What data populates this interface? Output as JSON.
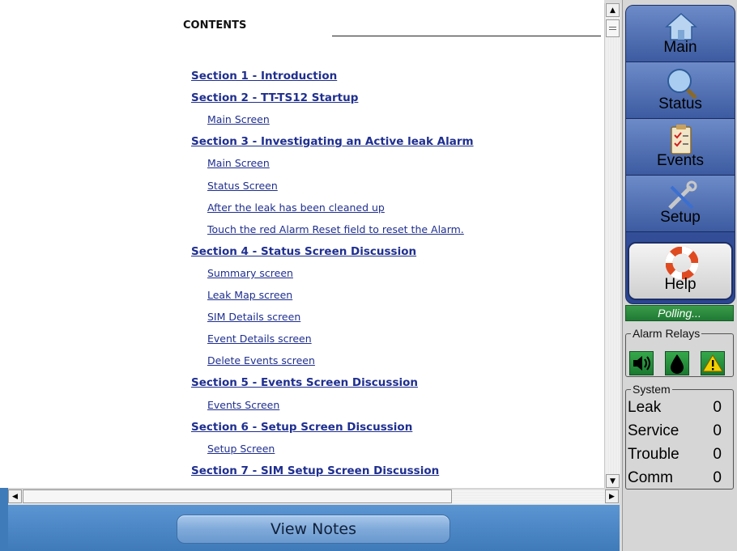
{
  "document": {
    "contents_title": "CONTENTS",
    "toc": [
      {
        "label": "Section 1 - Introduction",
        "level": "section"
      },
      {
        "label": "Section 2 - TT-TS12 Startup",
        "level": "section"
      },
      {
        "label": "Main Screen",
        "level": "sub"
      },
      {
        "label": "Section 3 - Investigating an Active leak Alarm",
        "level": "section"
      },
      {
        "label": "Main Screen",
        "level": "sub"
      },
      {
        "label": "Status Screen",
        "level": "sub"
      },
      {
        "label": "After the leak has been cleaned up",
        "level": "sub"
      },
      {
        "label": "Touch the red Alarm Reset field to reset the Alarm.",
        "level": "sub"
      },
      {
        "label": "Section 4 - Status Screen Discussion",
        "level": "section"
      },
      {
        "label": "Summary screen",
        "level": "sub"
      },
      {
        "label": "Leak Map screen",
        "level": "sub"
      },
      {
        "label": "SIM Details screen",
        "level": "sub"
      },
      {
        "label": "Event Details screen",
        "level": "sub"
      },
      {
        "label": "Delete Events screen",
        "level": "sub"
      },
      {
        "label": "Section 5 - Events Screen Discussion",
        "level": "section"
      },
      {
        "label": "Events Screen",
        "level": "sub"
      },
      {
        "label": "Section 6 - Setup Screen Discussion",
        "level": "section"
      },
      {
        "label": "Setup Screen",
        "level": "sub"
      },
      {
        "label": "Section 7 - SIM Setup Screen Discussion",
        "level": "section"
      }
    ]
  },
  "bottom_bar": {
    "view_notes_label": "View Notes"
  },
  "nav": {
    "main_label": "Main",
    "status_label": "Status",
    "events_label": "Events",
    "setup_label": "Setup",
    "help_label": "Help"
  },
  "polling_status": "Polling...",
  "alarm_relays": {
    "title": "Alarm Relays",
    "icons": [
      "speaker-icon",
      "drop-icon",
      "warning-icon"
    ]
  },
  "system": {
    "title": "System",
    "rows": [
      {
        "label": "Leak",
        "value": "0"
      },
      {
        "label": "Service",
        "value": "0"
      },
      {
        "label": "Trouble",
        "value": "0"
      },
      {
        "label": "Comm",
        "value": "0"
      }
    ]
  },
  "colors": {
    "link": "#1f2f8f",
    "nav_blue": "#3c5ba1",
    "relay_green": "#1f7a33",
    "bottom_bar": "#4a86c5"
  }
}
